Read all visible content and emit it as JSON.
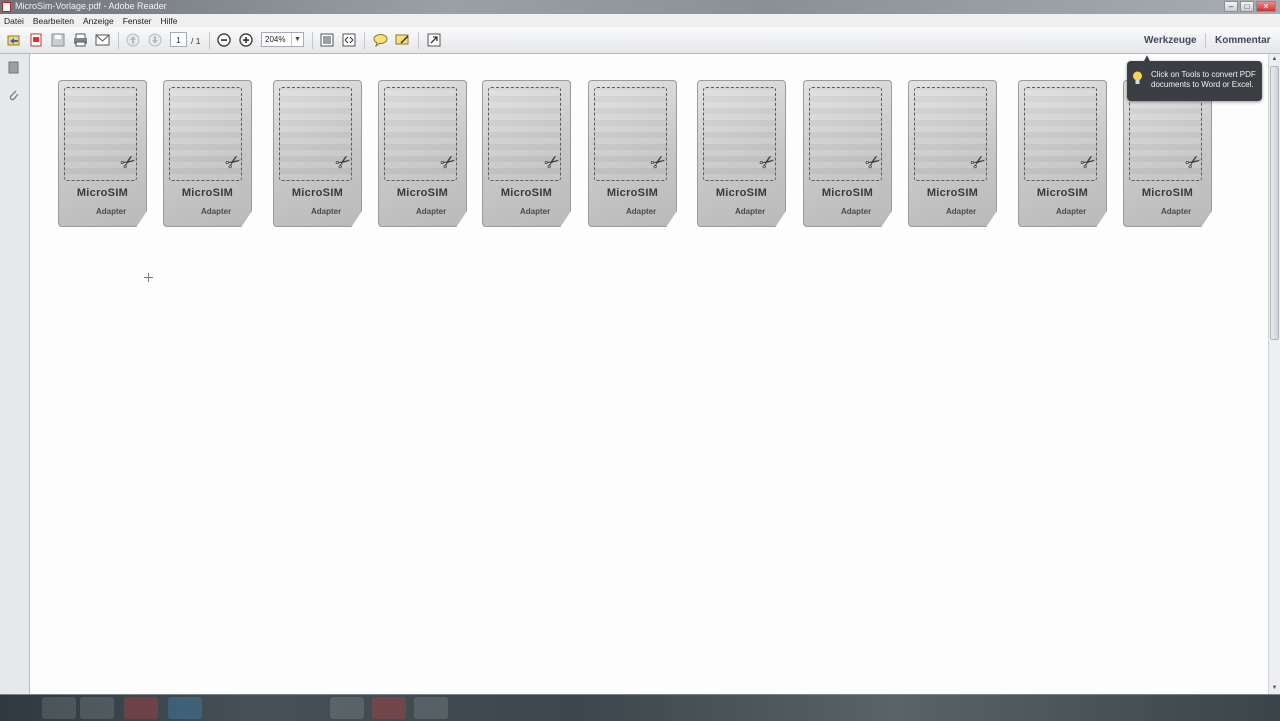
{
  "window": {
    "title": "MicroSim-Vorlage.pdf - Adobe Reader",
    "controls": [
      "–",
      "□",
      "✕"
    ]
  },
  "menu": [
    "Datei",
    "Bearbeiten",
    "Anzeige",
    "Fenster",
    "Hilfe"
  ],
  "toolbar": {
    "page_current": "1",
    "page_total": "/ 1",
    "zoom": "204%",
    "tools_label": "Werkzeuge",
    "comment_label": "Kommentar"
  },
  "tooltip": {
    "text": "Click on Tools to convert PDF documents to Word or Excel."
  },
  "sim_cards": [
    {
      "title": "MicroSIM",
      "subtitle": "Adapter"
    },
    {
      "title": "MicroSIM",
      "subtitle": "Adapter"
    },
    {
      "title": "MicroSIM",
      "subtitle": "Adapter"
    },
    {
      "title": "MicroSIM",
      "subtitle": "Adapter"
    },
    {
      "title": "MicroSIM",
      "subtitle": "Adapter"
    },
    {
      "title": "MicroSIM",
      "subtitle": "Adapter"
    },
    {
      "title": "MicroSIM",
      "subtitle": "Adapter"
    },
    {
      "title": "MicroSIM",
      "subtitle": "Adapter"
    },
    {
      "title": "MicroSIM",
      "subtitle": "Adapter"
    },
    {
      "title": "MicroSIM",
      "subtitle": "Adapter"
    },
    {
      "title": "MicroSIM",
      "subtitle": "Adapter"
    }
  ]
}
